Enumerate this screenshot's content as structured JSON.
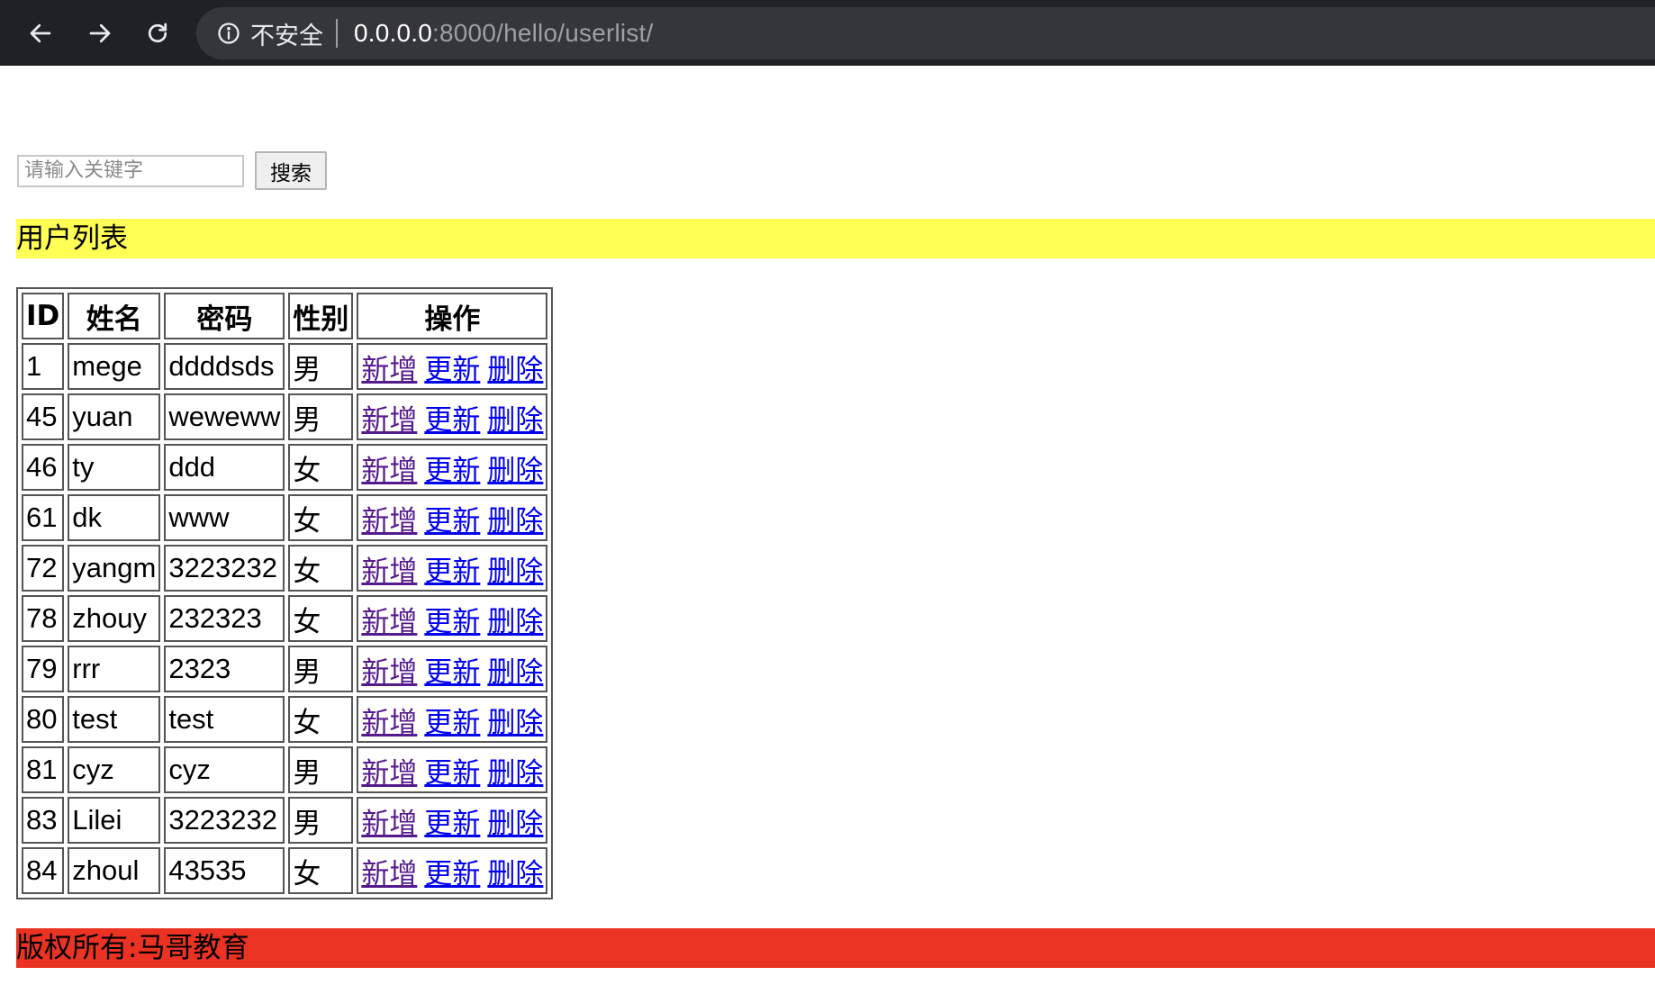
{
  "browser": {
    "security_label": "不安全",
    "url_host": "0.0.0.0",
    "url_rest": ":8000/hello/userlist/"
  },
  "search": {
    "placeholder": "请输入关键字",
    "value": "",
    "button_label": "搜索"
  },
  "heading": "用户列表",
  "table": {
    "headers": [
      "ID",
      "姓名",
      "密码",
      "性别",
      "操作"
    ],
    "actions": {
      "add": "新增",
      "update": "更新",
      "delete": "删除"
    },
    "rows": [
      {
        "id": "1",
        "name": "mege",
        "password": "ddddsds",
        "gender": "男"
      },
      {
        "id": "45",
        "name": "yuan",
        "password": "weweww",
        "gender": "男"
      },
      {
        "id": "46",
        "name": "ty",
        "password": "ddd",
        "gender": "女"
      },
      {
        "id": "61",
        "name": "dk",
        "password": "www",
        "gender": "女"
      },
      {
        "id": "72",
        "name": "yangm",
        "password": "3223232",
        "gender": "女"
      },
      {
        "id": "78",
        "name": "zhouy",
        "password": "232323",
        "gender": "女"
      },
      {
        "id": "79",
        "name": "rrr",
        "password": "2323",
        "gender": "男"
      },
      {
        "id": "80",
        "name": "test",
        "password": "test",
        "gender": "女"
      },
      {
        "id": "81",
        "name": "cyz",
        "password": "cyz",
        "gender": "男"
      },
      {
        "id": "83",
        "name": "Lilei",
        "password": "3223232",
        "gender": "男"
      },
      {
        "id": "84",
        "name": "zhoul",
        "password": "43535",
        "gender": "女"
      }
    ]
  },
  "footer": "版权所有:马哥教育",
  "colors": {
    "chrome_bg": "#202124",
    "omnibox_bg": "#35363a",
    "heading_bg": "#ffff55",
    "footer_bg": "#ea3323",
    "visited_link": "#551a8b",
    "link": "#0000ee"
  }
}
